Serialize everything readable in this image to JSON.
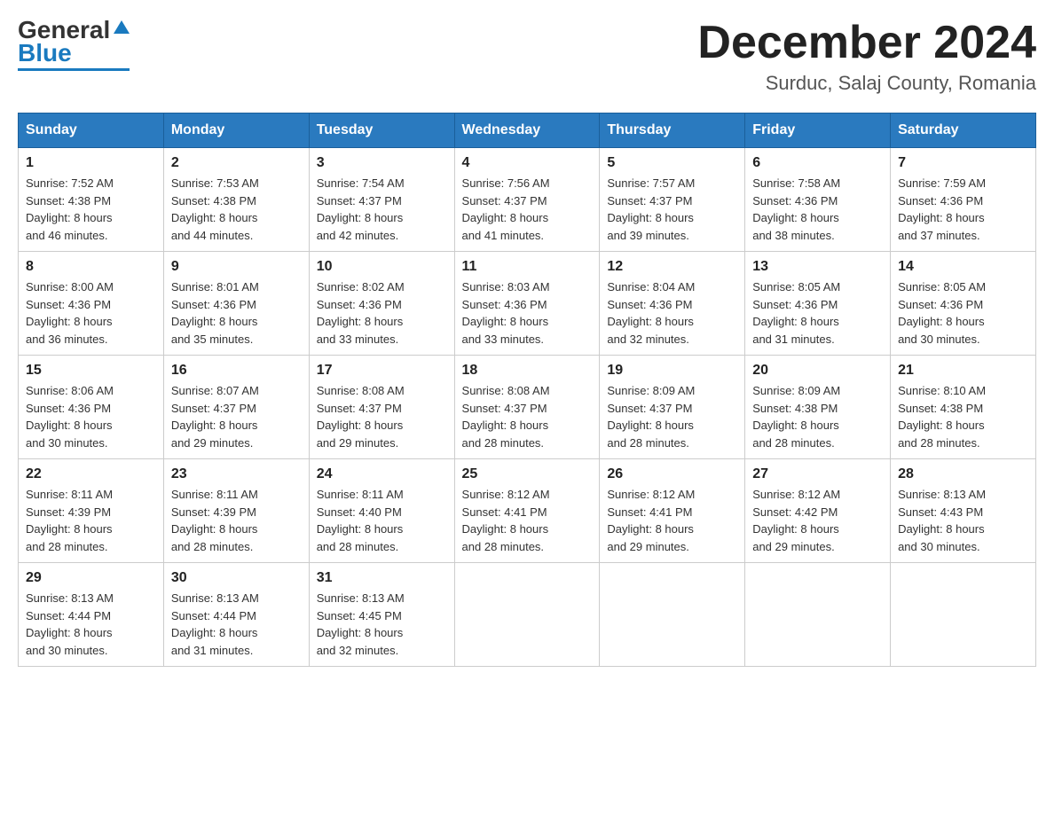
{
  "header": {
    "logo_general": "General",
    "logo_blue": "Blue",
    "title": "December 2024",
    "subtitle": "Surduc, Salaj County, Romania"
  },
  "days_of_week": [
    "Sunday",
    "Monday",
    "Tuesday",
    "Wednesday",
    "Thursday",
    "Friday",
    "Saturday"
  ],
  "weeks": [
    [
      {
        "day": "1",
        "sunrise": "7:52 AM",
        "sunset": "4:38 PM",
        "daylight": "8 hours and 46 minutes."
      },
      {
        "day": "2",
        "sunrise": "7:53 AM",
        "sunset": "4:38 PM",
        "daylight": "8 hours and 44 minutes."
      },
      {
        "day": "3",
        "sunrise": "7:54 AM",
        "sunset": "4:37 PM",
        "daylight": "8 hours and 42 minutes."
      },
      {
        "day": "4",
        "sunrise": "7:56 AM",
        "sunset": "4:37 PM",
        "daylight": "8 hours and 41 minutes."
      },
      {
        "day": "5",
        "sunrise": "7:57 AM",
        "sunset": "4:37 PM",
        "daylight": "8 hours and 39 minutes."
      },
      {
        "day": "6",
        "sunrise": "7:58 AM",
        "sunset": "4:36 PM",
        "daylight": "8 hours and 38 minutes."
      },
      {
        "day": "7",
        "sunrise": "7:59 AM",
        "sunset": "4:36 PM",
        "daylight": "8 hours and 37 minutes."
      }
    ],
    [
      {
        "day": "8",
        "sunrise": "8:00 AM",
        "sunset": "4:36 PM",
        "daylight": "8 hours and 36 minutes."
      },
      {
        "day": "9",
        "sunrise": "8:01 AM",
        "sunset": "4:36 PM",
        "daylight": "8 hours and 35 minutes."
      },
      {
        "day": "10",
        "sunrise": "8:02 AM",
        "sunset": "4:36 PM",
        "daylight": "8 hours and 33 minutes."
      },
      {
        "day": "11",
        "sunrise": "8:03 AM",
        "sunset": "4:36 PM",
        "daylight": "8 hours and 33 minutes."
      },
      {
        "day": "12",
        "sunrise": "8:04 AM",
        "sunset": "4:36 PM",
        "daylight": "8 hours and 32 minutes."
      },
      {
        "day": "13",
        "sunrise": "8:05 AM",
        "sunset": "4:36 PM",
        "daylight": "8 hours and 31 minutes."
      },
      {
        "day": "14",
        "sunrise": "8:05 AM",
        "sunset": "4:36 PM",
        "daylight": "8 hours and 30 minutes."
      }
    ],
    [
      {
        "day": "15",
        "sunrise": "8:06 AM",
        "sunset": "4:36 PM",
        "daylight": "8 hours and 30 minutes."
      },
      {
        "day": "16",
        "sunrise": "8:07 AM",
        "sunset": "4:37 PM",
        "daylight": "8 hours and 29 minutes."
      },
      {
        "day": "17",
        "sunrise": "8:08 AM",
        "sunset": "4:37 PM",
        "daylight": "8 hours and 29 minutes."
      },
      {
        "day": "18",
        "sunrise": "8:08 AM",
        "sunset": "4:37 PM",
        "daylight": "8 hours and 28 minutes."
      },
      {
        "day": "19",
        "sunrise": "8:09 AM",
        "sunset": "4:37 PM",
        "daylight": "8 hours and 28 minutes."
      },
      {
        "day": "20",
        "sunrise": "8:09 AM",
        "sunset": "4:38 PM",
        "daylight": "8 hours and 28 minutes."
      },
      {
        "day": "21",
        "sunrise": "8:10 AM",
        "sunset": "4:38 PM",
        "daylight": "8 hours and 28 minutes."
      }
    ],
    [
      {
        "day": "22",
        "sunrise": "8:11 AM",
        "sunset": "4:39 PM",
        "daylight": "8 hours and 28 minutes."
      },
      {
        "day": "23",
        "sunrise": "8:11 AM",
        "sunset": "4:39 PM",
        "daylight": "8 hours and 28 minutes."
      },
      {
        "day": "24",
        "sunrise": "8:11 AM",
        "sunset": "4:40 PM",
        "daylight": "8 hours and 28 minutes."
      },
      {
        "day": "25",
        "sunrise": "8:12 AM",
        "sunset": "4:41 PM",
        "daylight": "8 hours and 28 minutes."
      },
      {
        "day": "26",
        "sunrise": "8:12 AM",
        "sunset": "4:41 PM",
        "daylight": "8 hours and 29 minutes."
      },
      {
        "day": "27",
        "sunrise": "8:12 AM",
        "sunset": "4:42 PM",
        "daylight": "8 hours and 29 minutes."
      },
      {
        "day": "28",
        "sunrise": "8:13 AM",
        "sunset": "4:43 PM",
        "daylight": "8 hours and 30 minutes."
      }
    ],
    [
      {
        "day": "29",
        "sunrise": "8:13 AM",
        "sunset": "4:44 PM",
        "daylight": "8 hours and 30 minutes."
      },
      {
        "day": "30",
        "sunrise": "8:13 AM",
        "sunset": "4:44 PM",
        "daylight": "8 hours and 31 minutes."
      },
      {
        "day": "31",
        "sunrise": "8:13 AM",
        "sunset": "4:45 PM",
        "daylight": "8 hours and 32 minutes."
      },
      null,
      null,
      null,
      null
    ]
  ],
  "labels": {
    "sunrise_prefix": "Sunrise: ",
    "sunset_prefix": "Sunset: ",
    "daylight_prefix": "Daylight: "
  }
}
